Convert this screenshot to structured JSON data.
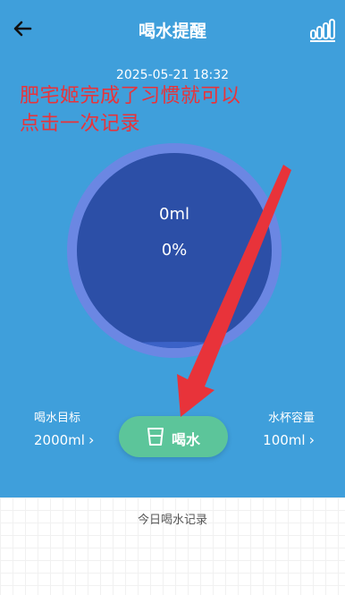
{
  "header": {
    "title": "喝水提醒",
    "back_icon": "arrow-left-icon",
    "stats_icon": "bar-chart-icon"
  },
  "datetime": "2025-05-21 18:32",
  "annotation": {
    "line1": "肥宅姬完成了习惯就可以",
    "line2": "点击一次记录",
    "color": "#e8333a"
  },
  "progress": {
    "amount": "0ml",
    "percent": "0%",
    "fill_fraction": 0.0
  },
  "goal": {
    "label": "喝水目标",
    "value": "2000ml"
  },
  "cup": {
    "label": "水杯容量",
    "value": "100ml"
  },
  "drink_button": {
    "label": "喝水",
    "icon": "cup-icon",
    "color": "#5cc59a"
  },
  "records": {
    "title": "今日喝水记录"
  },
  "colors": {
    "background": "#3f9fdb",
    "circle": "#2c4fa7",
    "ring": "#6b87e3"
  }
}
